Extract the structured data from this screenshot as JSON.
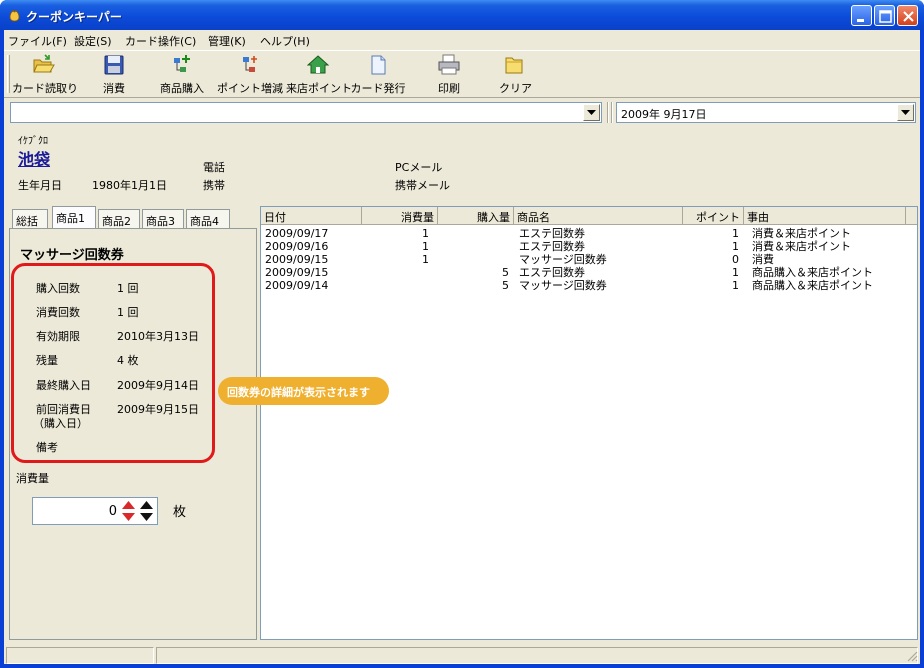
{
  "window": {
    "title": "クーポンキーパー"
  },
  "menu": [
    "ファイル(F)",
    "設定(S)",
    "カード操作(C)",
    "管理(K)",
    "ヘルプ(H)"
  ],
  "toolbar": {
    "read_card": "カード読取り",
    "consume": "消費",
    "purchase": "商品購入",
    "point_change": "ポイント増減",
    "visit_point": "来店ポイント",
    "issue_card": "カード発行",
    "print": "印刷",
    "clear": "クリア"
  },
  "search": {
    "value": ""
  },
  "date_combo": {
    "value": "2009年  9月17日"
  },
  "customer": {
    "kana": "ｲｹﾌﾞｸﾛ",
    "name": "池袋",
    "birth_label": "生年月日",
    "birth_value": "1980年1月1日",
    "phone_label": "電話",
    "mobile_label": "携帯",
    "pcmail_label": "PCメール",
    "mobilemail_label": "携帯メール"
  },
  "tabs": [
    "総括",
    "商品1",
    "商品2",
    "商品3",
    "商品4"
  ],
  "active_tab": "商品1",
  "detail": {
    "title": "マッサージ回数券",
    "purchase_count_label": "購入回数",
    "purchase_count_value": "1 回",
    "consume_count_label": "消費回数",
    "consume_count_value": "1 回",
    "expiry_label": "有効期限",
    "expiry_value": "2010年3月13日",
    "remaining_label": "残量",
    "remaining_value": "4 枚",
    "last_purchase_label": "最終購入日",
    "last_purchase_value": "2009年9月14日",
    "prev_consume_label1": "前回消費日",
    "prev_consume_label2": "（購入日）",
    "prev_consume_value": "2009年9月15日",
    "note_label": "備考"
  },
  "callout": "回数券の詳細が表示されます",
  "quantity": {
    "label": "消費量",
    "value": "0",
    "unit": "枚"
  },
  "table": {
    "columns": [
      "日付",
      "消費量",
      "購入量",
      "商品名",
      "ポイント",
      "事由"
    ],
    "rows": [
      [
        "2009/09/17",
        "1",
        "",
        "エステ回数券",
        "1",
        "消費＆来店ポイント"
      ],
      [
        "2009/09/16",
        "1",
        "",
        "エステ回数券",
        "1",
        "消費＆来店ポイント"
      ],
      [
        "2009/09/15",
        "1",
        "",
        "マッサージ回数券",
        "0",
        "消費"
      ],
      [
        "2009/09/15",
        "",
        "5",
        "エステ回数券",
        "1",
        "商品購入＆来店ポイント"
      ],
      [
        "2009/09/14",
        "",
        "5",
        "マッサージ回数券",
        "1",
        "商品購入＆来店ポイント"
      ]
    ]
  },
  "colors": {
    "title_bar": "#0b4ad8",
    "client_bg": "#ece9d8",
    "highlight_box": "#e01a1a",
    "callout": "#efb030",
    "link": "#1a1a9a"
  }
}
